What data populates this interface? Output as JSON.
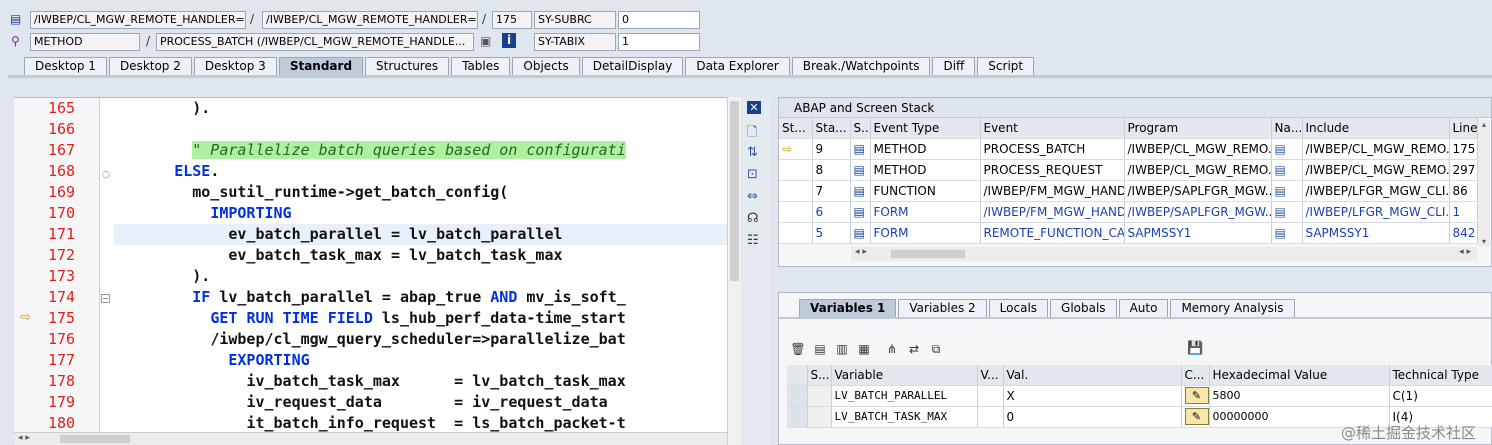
{
  "header": {
    "row1": {
      "icon": "program-icon",
      "field1": "/IWBEP/CL_MGW_REMOTE_HANDLER=...",
      "field2": "/IWBEP/CL_MGW_REMOTE_HANDLER=...",
      "line": "175",
      "var_name": "SY-SUBRC",
      "var_value": "0"
    },
    "row2": {
      "icon": "method-icon",
      "type": "METHOD",
      "name": "PROCESS_BATCH (/IWBEP/CL_MGW_REMOTE_HANDLE...",
      "var_name": "SY-TABIX",
      "var_value": "1"
    }
  },
  "tabs": [
    "Desktop 1",
    "Desktop 2",
    "Desktop 3",
    "Standard",
    "Structures",
    "Tables",
    "Objects",
    "DetailDisplay",
    "Data Explorer",
    "Break./Watchpoints",
    "Diff",
    "Script"
  ],
  "active_tab": "Standard",
  "code_lines": [
    {
      "n": "165",
      "code": "        )."
    },
    {
      "n": "166",
      "code": ""
    },
    {
      "n": "167",
      "code": "        \" Parallelize batch queries based on configurati"
    },
    {
      "n": "168",
      "code": "      ELSE."
    },
    {
      "n": "169",
      "code": "        mo_sutil_runtime->get_batch_config("
    },
    {
      "n": "170",
      "code": "          IMPORTING"
    },
    {
      "n": "171",
      "code": "            ev_batch_parallel = lv_batch_parallel"
    },
    {
      "n": "172",
      "code": "            ev_batch_task_max = lv_batch_task_max"
    },
    {
      "n": "173",
      "code": "        )."
    },
    {
      "n": "174",
      "code": "        IF lv_batch_parallel = abap_true AND mv_is_soft_"
    },
    {
      "n": "175",
      "code": "          GET RUN TIME FIELD ls_hub_perf_data-time_start"
    },
    {
      "n": "176",
      "code": "          /iwbep/cl_mgw_query_scheduler=>parallelize_bat"
    },
    {
      "n": "177",
      "code": "            EXPORTING"
    },
    {
      "n": "178",
      "code": "              iv_batch_task_max      = lv_batch_task_max"
    },
    {
      "n": "179",
      "code": "              iv_request_data        = iv_request_data"
    },
    {
      "n": "180",
      "code": "              it_batch_info_request  = ls_batch_packet-t"
    }
  ],
  "stack": {
    "title": "ABAP and Screen Stack",
    "columns": [
      "St...",
      "Sta...",
      "S..",
      "Event Type",
      "Event",
      "Program",
      "Na...",
      "Include",
      "Line"
    ],
    "rows": [
      {
        "st": "⇨",
        "sta": "9",
        "type": "METHOD",
        "event": "PROCESS_BATCH",
        "program": "/IWBEP/CL_MGW_REMO...",
        "include": "/IWBEP/CL_MGW_REMO...",
        "line": "175",
        "link": false
      },
      {
        "st": "",
        "sta": "8",
        "type": "METHOD",
        "event": "PROCESS_REQUEST",
        "program": "/IWBEP/CL_MGW_REMO...",
        "include": "/IWBEP/CL_MGW_REMO...",
        "line": "297",
        "link": false
      },
      {
        "st": "",
        "sta": "7",
        "type": "FUNCTION",
        "event": "/IWBEP/FM_MGW_HAND...",
        "program": "/IWBEP/SAPLFGR_MGW...",
        "include": "/IWBEP/LFGR_MGW_CLI...",
        "line": "86",
        "link": false
      },
      {
        "st": "",
        "sta": "6",
        "type": "FORM",
        "event": "/IWBEP/FM_MGW_HAND...",
        "program": "/IWBEP/SAPLFGR_MGW...",
        "include": "/IWBEP/LFGR_MGW_CLI...",
        "line": "1",
        "link": true
      },
      {
        "st": "",
        "sta": "5",
        "type": "FORM",
        "event": "REMOTE_FUNCTION_CA...",
        "program": "SAPMSSY1",
        "include": "SAPMSSY1",
        "line": "842",
        "link": true
      }
    ]
  },
  "var_tabs": [
    "Variables 1",
    "Variables 2",
    "Locals",
    "Globals",
    "Auto",
    "Memory Analysis"
  ],
  "active_var_tab": "Variables 1",
  "variables": {
    "columns": [
      "S...",
      "Variable",
      "V...",
      "Val.",
      "C...",
      "Hexadecimal Value",
      "Technical Type"
    ],
    "rows": [
      {
        "name": "LV_BATCH_PARALLEL",
        "val": "X",
        "hex": "5800",
        "type": "C(1)"
      },
      {
        "name": "LV_BATCH_TASK_MAX",
        "val": "0",
        "hex": "00000000",
        "type": "I(4)"
      }
    ]
  },
  "watermark": "@稀土掘金技术社区"
}
